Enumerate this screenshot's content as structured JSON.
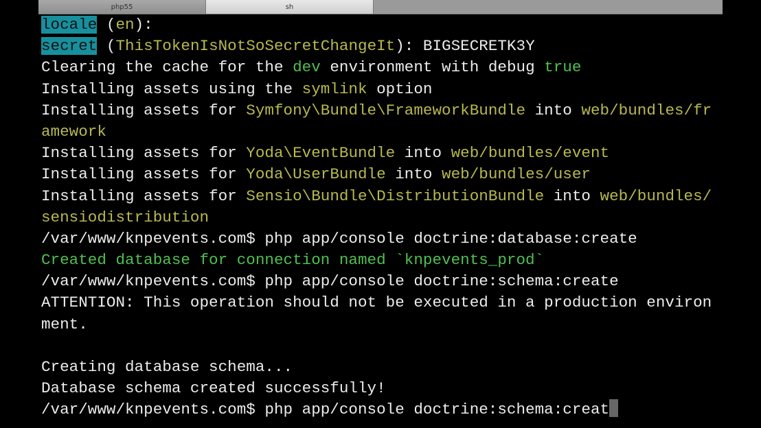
{
  "tabs": [
    {
      "label": "php55",
      "active": false
    },
    {
      "label": "sh",
      "active": true
    }
  ],
  "lines": [
    [
      {
        "t": "locale",
        "c": "hl"
      },
      {
        "t": " ("
      },
      {
        "t": "en",
        "c": "y"
      },
      {
        "t": "):"
      }
    ],
    [
      {
        "t": "secret",
        "c": "hl"
      },
      {
        "t": " ("
      },
      {
        "t": "ThisTokenIsNotSoSecretChangeIt",
        "c": "y"
      },
      {
        "t": "): BIGSECRETK3Y"
      }
    ],
    [
      {
        "t": "Clearing the cache for the "
      },
      {
        "t": "dev",
        "c": "g"
      },
      {
        "t": " environment with debug "
      },
      {
        "t": "true",
        "c": "g"
      }
    ],
    [
      {
        "t": "Installing assets using the "
      },
      {
        "t": "symlink",
        "c": "y"
      },
      {
        "t": " option"
      }
    ],
    [
      {
        "t": "Installing assets for "
      },
      {
        "t": "Symfony\\Bundle\\FrameworkBundle",
        "c": "y"
      },
      {
        "t": " into "
      },
      {
        "t": "web/bundles/fr",
        "c": "y"
      }
    ],
    [
      {
        "t": "amework",
        "c": "y"
      }
    ],
    [
      {
        "t": "Installing assets for "
      },
      {
        "t": "Yoda\\EventBundle",
        "c": "y"
      },
      {
        "t": " into "
      },
      {
        "t": "web/bundles/event",
        "c": "y"
      }
    ],
    [
      {
        "t": "Installing assets for "
      },
      {
        "t": "Yoda\\UserBundle",
        "c": "y"
      },
      {
        "t": " into "
      },
      {
        "t": "web/bundles/user",
        "c": "y"
      }
    ],
    [
      {
        "t": "Installing assets for "
      },
      {
        "t": "Sensio\\Bundle\\DistributionBundle",
        "c": "y"
      },
      {
        "t": " into "
      },
      {
        "t": "web/bundles/",
        "c": "y"
      }
    ],
    [
      {
        "t": "sensiodistribution",
        "c": "y"
      }
    ],
    [
      {
        "t": "/var/www/knpevents.com$ php app/console doctrine:database:create"
      }
    ],
    [
      {
        "t": "Created database for connection named `knpevents_prod`",
        "c": "g"
      }
    ],
    [
      {
        "t": "/var/www/knpevents.com$ php app/console doctrine:schema:create"
      }
    ],
    [
      {
        "t": "ATTENTION: This operation should not be executed in a production environ"
      }
    ],
    [
      {
        "t": "ment."
      }
    ],
    [],
    [
      {
        "t": "Creating database schema..."
      }
    ],
    [
      {
        "t": "Database schema created successfully!"
      }
    ],
    [
      {
        "t": "/var/www/knpevents.com$ php app/console doctrine:schema:creat"
      }
    ]
  ]
}
